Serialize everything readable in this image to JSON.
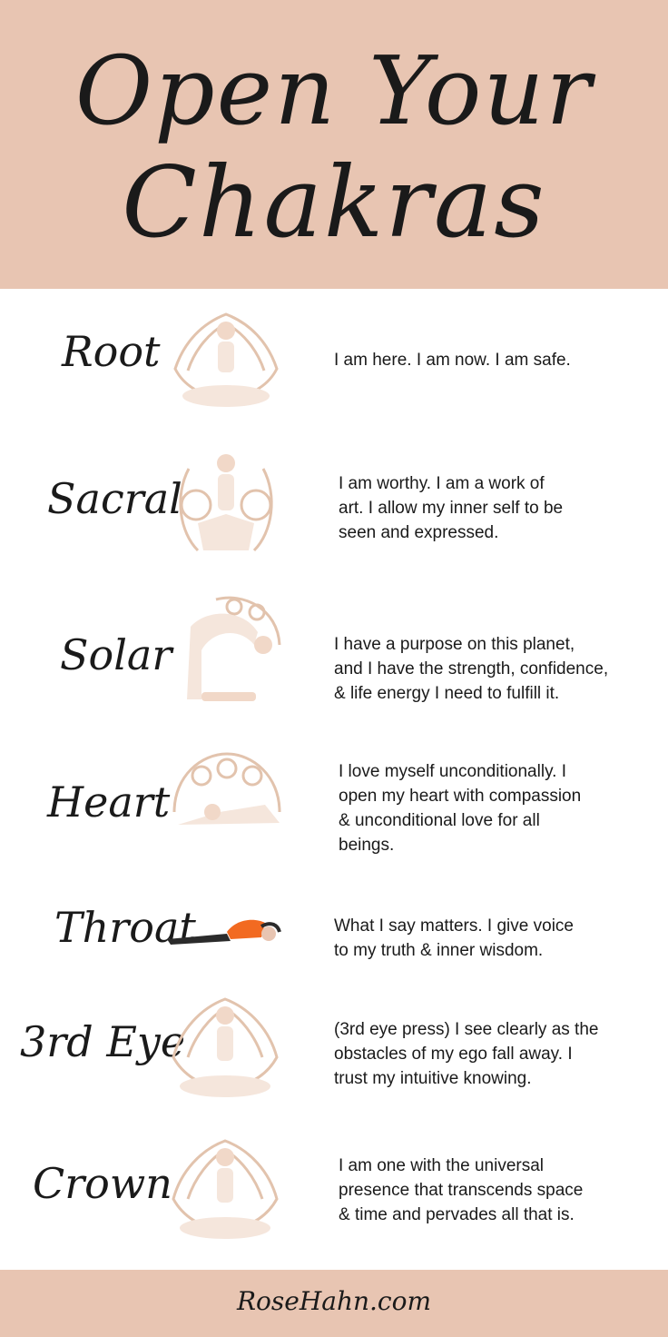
{
  "title": {
    "line1": "Open Your",
    "line2": "Chakras"
  },
  "colors": {
    "header_bg": "#e8c5b2",
    "figure_accent": "#e2c3ad",
    "throat_accent": "#f26a21",
    "throat_dark": "#2b2b2b"
  },
  "chakras": [
    {
      "name": "Root",
      "icon": "lotus-meditation-figure-icon",
      "affirmation": [
        "I am here. I am now. I am safe."
      ]
    },
    {
      "name": "Sacral",
      "icon": "squat-prayer-pose-icon",
      "affirmation": [
        "I am worthy. I am a work of",
        "art. I allow my inner self to be",
        "seen and expressed."
      ]
    },
    {
      "name": "Solar",
      "icon": "camel-pose-icon",
      "affirmation": [
        "I have a purpose on this planet,",
        "and I have the strength, confidence,",
        "& life energy I need to fulfill it."
      ]
    },
    {
      "name": "Heart",
      "icon": "childs-pose-icon",
      "affirmation": [
        "I love myself unconditionally. I",
        "open my heart with compassion",
        "& unconditional love for all",
        "beings."
      ]
    },
    {
      "name": "Throat",
      "icon": "fish-pose-icon",
      "affirmation": [
        "What I say matters. I give voice",
        "to my truth & inner wisdom."
      ]
    },
    {
      "name": "3rd Eye",
      "icon": "seated-meditation-icon",
      "affirmation": [
        "(3rd eye press) I see clearly as the",
        "obstacles of my ego fall away. I",
        "trust my intuitive knowing."
      ]
    },
    {
      "name": "Crown",
      "icon": "seated-meditation-icon",
      "affirmation": [
        "I am one with the universal",
        "presence that transcends space",
        "& time and pervades all that is."
      ]
    }
  ],
  "footer": {
    "text": "RoseHahn.com"
  }
}
